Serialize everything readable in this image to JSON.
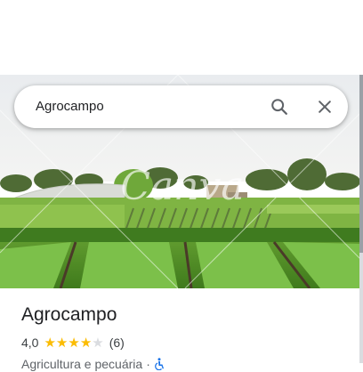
{
  "search": {
    "query": "Agrocampo"
  },
  "hero": {
    "watermark": "Canva"
  },
  "place": {
    "name": "Agrocampo",
    "rating": "4,0",
    "rating_value": 4.0,
    "stars_max": 5,
    "review_count": "(6)",
    "category": "Agricultura e pecuária",
    "separator": "·",
    "accessibility_icon": "wheelchair-icon"
  },
  "colors": {
    "star": "#fbbc04",
    "star_empty": "#dadce0",
    "accessibility": "#1a73e8"
  }
}
